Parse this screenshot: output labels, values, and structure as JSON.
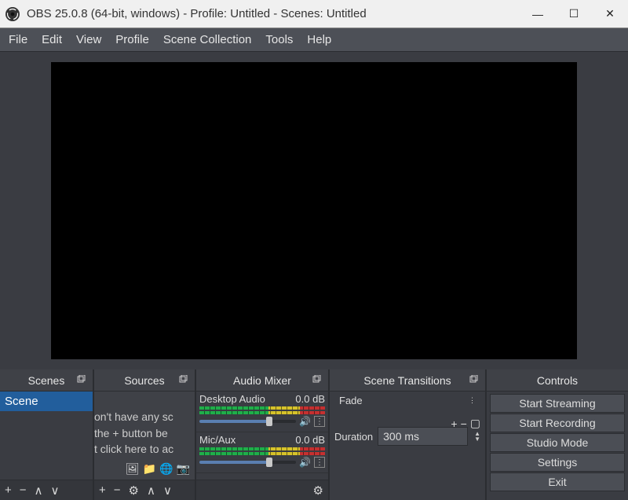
{
  "window": {
    "title": "OBS 25.0.8 (64-bit, windows) - Profile: Untitled - Scenes: Untitled"
  },
  "menu": {
    "file": "File",
    "edit": "Edit",
    "view": "View",
    "profile": "Profile",
    "scene_collection": "Scene Collection",
    "tools": "Tools",
    "help": "Help"
  },
  "docks": {
    "scenes": {
      "title": "Scenes",
      "items": [
        "Scene"
      ]
    },
    "sources": {
      "title": "Sources",
      "placeholder": "on't have any sc\n the + button be\nt click here to ac"
    },
    "mixer": {
      "title": "Audio Mixer",
      "channels": [
        {
          "name": "Desktop Audio",
          "level": "0.0 dB"
        },
        {
          "name": "Mic/Aux",
          "level": "0.0 dB"
        }
      ]
    },
    "transitions": {
      "title": "Scene Transitions",
      "current": "Fade",
      "duration_label": "Duration",
      "duration_value": "300 ms"
    },
    "controls": {
      "title": "Controls",
      "buttons": {
        "start_streaming": "Start Streaming",
        "start_recording": "Start Recording",
        "studio_mode": "Studio Mode",
        "settings": "Settings",
        "exit": "Exit"
      }
    }
  },
  "symbols": {
    "plus": "+",
    "minus": "−",
    "gear": "⚙",
    "up": "∧",
    "down": "∨",
    "square": "▢",
    "speaker": "🔊",
    "image": "🖼",
    "folder": "📁",
    "globe": "🌐",
    "camera": "📷",
    "dots": "⋮",
    "min": "—",
    "max": "☐",
    "close": "✕"
  }
}
